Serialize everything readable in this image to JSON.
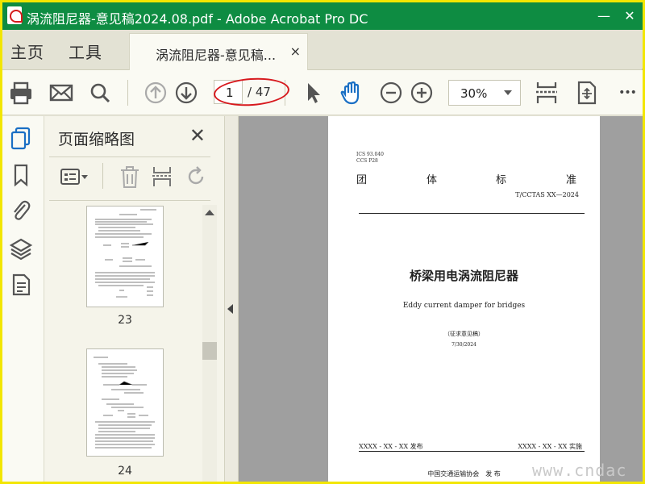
{
  "window": {
    "title": "涡流阻尼器-意见稿2024.08.pdf - Adobe Acrobat Pro DC",
    "minimize_glyph": "—",
    "close_glyph": "✕"
  },
  "nav_tabs": {
    "home": "主页",
    "tools": "工具"
  },
  "doc_tab": {
    "label": "涡流阻尼器-意见稿...",
    "close_glyph": "×"
  },
  "toolbar": {
    "current_page": "1",
    "total_pages": "/ 47",
    "zoom": "30%",
    "more_glyph": "•••",
    "icons": [
      "print-icon",
      "email-icon",
      "search-icon",
      "page-up-icon",
      "page-down-icon",
      "select-cursor-icon",
      "hand-tool-icon",
      "zoom-out-icon",
      "zoom-in-icon",
      "scroll-mode-icon",
      "fit-page-icon",
      "more-icon"
    ]
  },
  "left_rail": {
    "icons": [
      "page-thumbnails-icon",
      "bookmark-icon",
      "attachment-icon",
      "layers-icon",
      "document-icon"
    ]
  },
  "thumbnails_panel": {
    "title": "页面缩略图",
    "close_glyph": "✕",
    "items": [
      {
        "page": "23"
      },
      {
        "page": "24"
      }
    ]
  },
  "document_page": {
    "ics": "ICS  93.040",
    "ccs": "CCS  P28",
    "group_standard": [
      "团",
      "体",
      "标",
      "准"
    ],
    "standard_no": "T/CCTAS XX—2024",
    "title_cn": "桥梁用电涡流阻尼器",
    "title_en": "Eddy current damper for bridges",
    "draft": "（征求意见稿）",
    "date": "7/30/2024",
    "publish": "XXXX - XX - XX 发布",
    "implement": "XXXX - XX - XX 实施",
    "org": "中国交通运输协会　发 布"
  },
  "watermark": "www.cndac",
  "colors": {
    "titlebar": "#0e8c42",
    "frame": "#f2e600",
    "annotation": "#d7181d",
    "hand_tool": "#1a6fc4"
  }
}
